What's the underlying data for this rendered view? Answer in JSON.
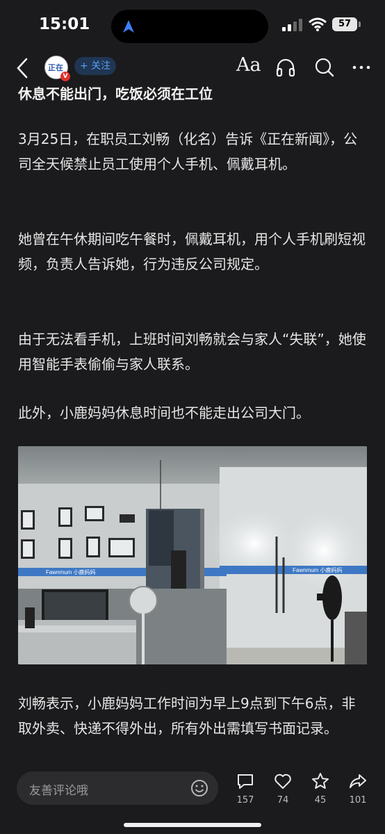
{
  "status_bar": {
    "time": "15:01",
    "battery": "57"
  },
  "nav": {
    "follow_label": "+ 关注",
    "font_size_label": "Aa",
    "avatar_text": "正在"
  },
  "article": {
    "heading": "休息不能出门，吃饭必须在工位",
    "paragraphs": [
      "3月25日，在职员工刘畅（化名）告诉《正在新闻》，公司全天候禁止员工使用个人手机、佩戴耳机。",
      "她曾在午休期间吃午餐时，佩戴耳机，用个人手机刷短视频，负责人告诉她，行为违反公司规定。",
      "由于无法看手机，上班时间刘畅就会与家人“失联”，她使用智能手表偷偷与家人联系。",
      "此外，小鹿妈妈休息时间也不能走出公司大门。",
      "刘畅表示，小鹿妈妈工作时间为早上9点到下午6点，非取外卖、快递不得外出，所有外出需填写书面记录。"
    ],
    "photo": {
      "wall_text_left": "Fawnmum 小鹿妈妈",
      "wall_text_right": "Fawnmum 小鹿妈妈"
    }
  },
  "bottom": {
    "comment_placeholder": "友善评论哦",
    "comments": "157",
    "likes": "74",
    "favorites": "45",
    "shares": "101"
  },
  "colors": {
    "background": "#1b1b1d",
    "accent": "#5b9df0",
    "follow_bg": "#1f3552"
  }
}
